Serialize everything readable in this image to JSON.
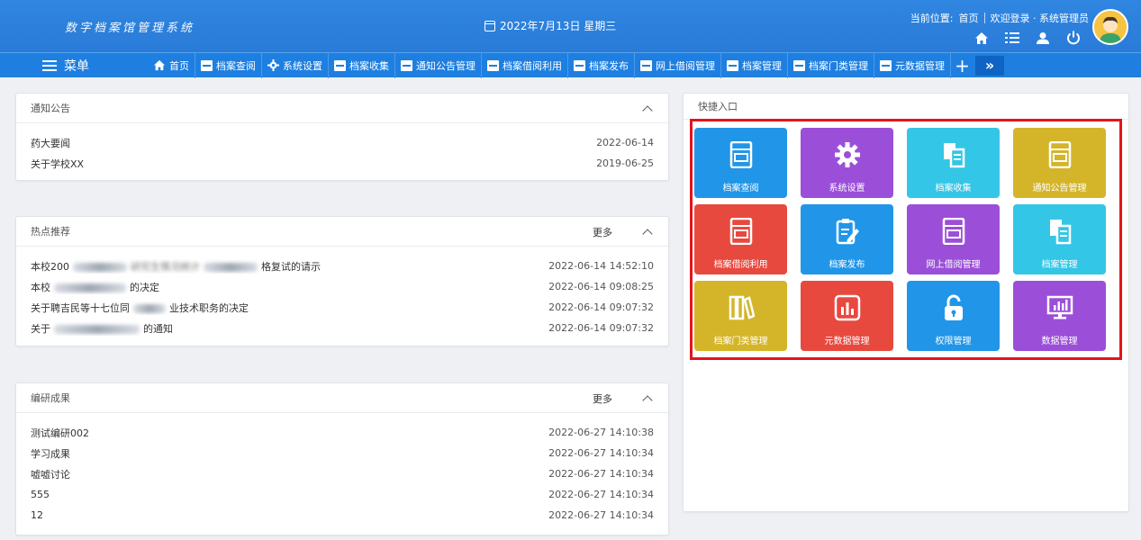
{
  "header": {
    "logo_text": "数字档案馆管理系统",
    "date": "2022年7月13日 星期三",
    "location_label": "当前位置:",
    "location_value": "首页",
    "welcome": "欢迎登录 · 系统管理员",
    "icons": [
      "home-icon",
      "list-icon",
      "user-icon",
      "power-icon"
    ]
  },
  "nav": {
    "menu_label": "菜单",
    "items": [
      {
        "label": "首页",
        "icon": "home-icon"
      },
      {
        "label": "档案查阅",
        "icon": "archive-box-icon"
      },
      {
        "label": "系统设置",
        "icon": "gear-icon"
      },
      {
        "label": "档案收集",
        "icon": "documents-icon"
      },
      {
        "label": "通知公告管理",
        "icon": "archive-box-icon"
      },
      {
        "label": "档案借阅利用",
        "icon": "archive-box-icon"
      },
      {
        "label": "档案发布",
        "icon": "clipboard-edit-icon"
      },
      {
        "label": "网上借阅管理",
        "icon": "archive-box-icon"
      },
      {
        "label": "档案管理",
        "icon": "documents-icon"
      },
      {
        "label": "档案门类管理",
        "icon": "binders-icon"
      },
      {
        "label": "元数据管理",
        "icon": "chart-box-icon"
      }
    ],
    "plus": "+",
    "more": "»"
  },
  "notice": {
    "title": "通知公告",
    "rows": [
      {
        "text": "药大要闻",
        "date": "2022-06-14"
      },
      {
        "text": "关于学校XX",
        "date": "2019-06-25"
      }
    ]
  },
  "hot": {
    "title": "热点推荐",
    "more": "更多",
    "rows": [
      {
        "text_a": "本校200",
        "text_b": "研究生情况统计",
        "text_c": "格复试的请示",
        "date": "2022-06-14 14:52:10"
      },
      {
        "text_a": "本校",
        "text_b": "",
        "text_c": "的决定",
        "date": "2022-06-14 09:08:25"
      },
      {
        "text_a": "关于聘吉民等十七位同",
        "text_b": "",
        "text_c": "业技术职务的决定",
        "date": "2022-06-14 09:07:32"
      },
      {
        "text_a": "关于",
        "text_b": "",
        "text_c": "的通知",
        "date": "2022-06-14 09:07:32"
      }
    ]
  },
  "research": {
    "title": "编研成果",
    "more": "更多",
    "rows": [
      {
        "text": "测试编研002",
        "date": "2022-06-27 14:10:38"
      },
      {
        "text": "学习成果",
        "date": "2022-06-27 14:10:34"
      },
      {
        "text": "嘘嘘讨论",
        "date": "2022-06-27 14:10:34"
      },
      {
        "text": "555",
        "date": "2022-06-27 14:10:34"
      },
      {
        "text": "12",
        "date": "2022-06-27 14:10:34"
      }
    ]
  },
  "quick": {
    "title": "快捷入口",
    "tiles": [
      {
        "label": "档案查阅",
        "color": "#2196e8",
        "icon": "archive-box-icon"
      },
      {
        "label": "系统设置",
        "color": "#9b4fd9",
        "icon": "gear-icon"
      },
      {
        "label": "档案收集",
        "color": "#34c6e6",
        "icon": "documents-icon"
      },
      {
        "label": "通知公告管理",
        "color": "#d4b52a",
        "icon": "archive-box-icon"
      },
      {
        "label": "档案借阅利用",
        "color": "#e8493f",
        "icon": "archive-box-icon"
      },
      {
        "label": "档案发布",
        "color": "#2196e8",
        "icon": "clipboard-edit-icon"
      },
      {
        "label": "网上借阅管理",
        "color": "#9b4fd9",
        "icon": "archive-box-icon"
      },
      {
        "label": "档案管理",
        "color": "#34c6e6",
        "icon": "documents-icon"
      },
      {
        "label": "档案门类管理",
        "color": "#d4b52a",
        "icon": "binders-icon"
      },
      {
        "label": "元数据管理",
        "color": "#e8493f",
        "icon": "chart-box-icon"
      },
      {
        "label": "权限管理",
        "color": "#2196e8",
        "icon": "unlock-icon"
      },
      {
        "label": "数据管理",
        "color": "#9b4fd9",
        "icon": "monitor-chart-icon"
      }
    ]
  }
}
